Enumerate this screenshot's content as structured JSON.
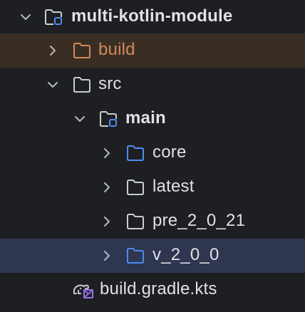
{
  "project_tree": {
    "root": {
      "label": "multi-kotlin-module",
      "expanded": true,
      "icon": "module-folder-icon"
    },
    "items": [
      {
        "label": "build",
        "expanded": false,
        "icon": "excluded-folder-icon",
        "state": "excluded"
      },
      {
        "label": "src",
        "expanded": true,
        "icon": "folder-icon"
      },
      {
        "label": "main",
        "expanded": true,
        "icon": "module-folder-icon"
      },
      {
        "label": "core",
        "expanded": false,
        "icon": "source-folder-icon"
      },
      {
        "label": "latest",
        "expanded": false,
        "icon": "folder-icon"
      },
      {
        "label": "pre_2_0_21",
        "expanded": false,
        "icon": "folder-icon"
      },
      {
        "label": "v_2_0_0",
        "expanded": false,
        "icon": "source-folder-icon",
        "state": "selected"
      },
      {
        "label": "build.gradle.kts",
        "icon": "gradle-kotlin-script-icon"
      }
    ]
  },
  "colors": {
    "background": "#1e1f22",
    "excluded_row": "#3a2e24",
    "selected_row": "#2e3650",
    "text": "#dfe1e5",
    "excluded_text": "#d18a5a",
    "source_folder": "#4d8df0",
    "folder_outline": "#c9ccd1",
    "module_marker": "#4d8df0",
    "kotlin_purple": "#9a73f2"
  }
}
